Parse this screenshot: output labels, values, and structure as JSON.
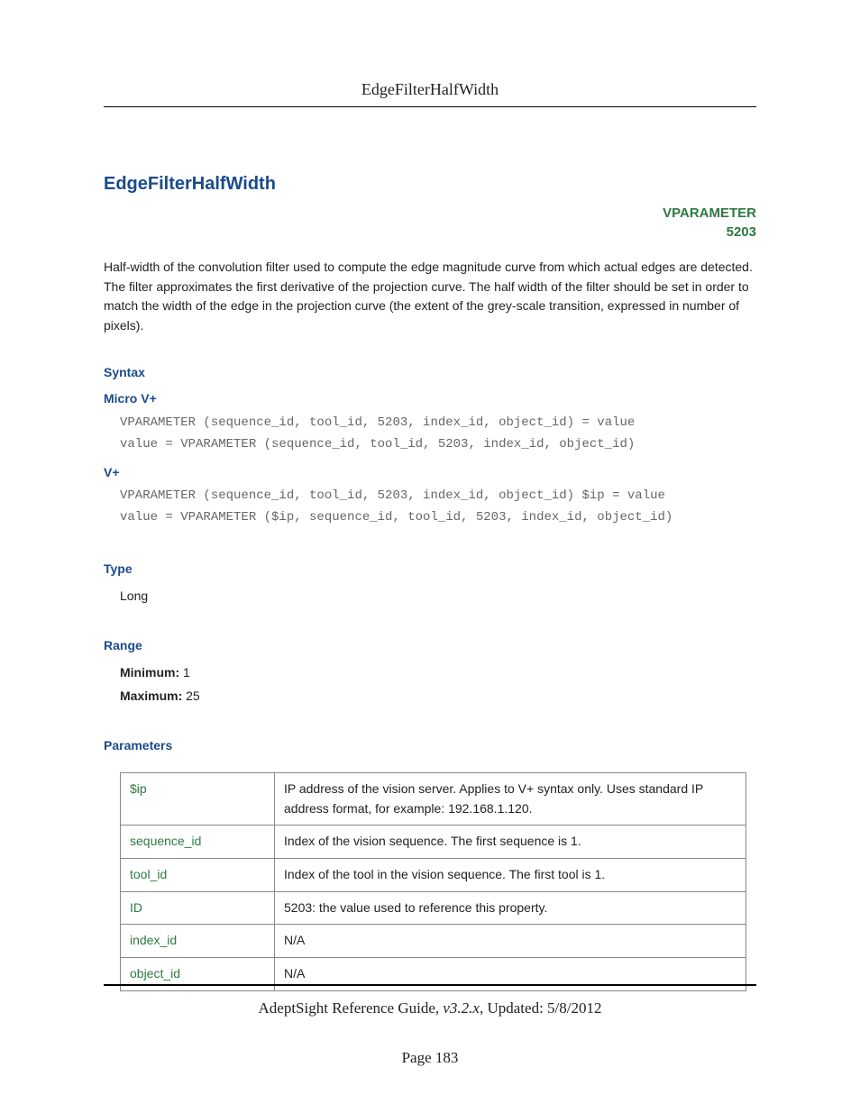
{
  "header": {
    "running_title": "EdgeFilterHalfWidth"
  },
  "title": "EdgeFilterHalfWidth",
  "vparam": {
    "label": "VPARAMETER",
    "id": "5203"
  },
  "description": "Half-width of the convolution filter used to compute the edge magnitude curve from which actual edges are detected. The filter approximates the first derivative of the projection curve. The half width of the filter should be set in order to match the width of the edge in the projection curve (the extent of the grey-scale transition, expressed in number of pixels).",
  "syntax": {
    "heading": "Syntax",
    "micro_heading": "Micro V+",
    "micro_code": "VPARAMETER (sequence_id, tool_id, 5203, index_id, object_id) = value\nvalue = VPARAMETER (sequence_id, tool_id, 5203, index_id, object_id)",
    "vplus_heading": "V+",
    "vplus_code": "VPARAMETER (sequence_id, tool_id, 5203, index_id, object_id) $ip = value\nvalue = VPARAMETER ($ip, sequence_id, tool_id, 5203, index_id, object_id)"
  },
  "type_section": {
    "heading": "Type",
    "value": "Long"
  },
  "range": {
    "heading": "Range",
    "min_label": "Minimum:",
    "min_value": "1",
    "max_label": "Maximum:",
    "max_value": "25"
  },
  "parameters": {
    "heading": "Parameters",
    "rows": [
      {
        "name": "$ip",
        "desc": "IP address of the vision server. Applies to V+ syntax only. Uses standard IP address format, for example: 192.168.1.120."
      },
      {
        "name": "sequence_id",
        "desc": "Index of the vision sequence. The first sequence is 1."
      },
      {
        "name": "tool_id",
        "desc": "Index of the tool in the vision sequence. The first tool is 1."
      },
      {
        "name": "ID",
        "desc": "5203: the value used to reference this property."
      },
      {
        "name": "index_id",
        "desc": "N/A"
      },
      {
        "name": "object_id",
        "desc": "N/A"
      }
    ]
  },
  "footer": {
    "guide": "AdeptSight Reference Guide",
    "version": ", v3.2.x",
    "updated": ", Updated: 5/8/2012",
    "page": "Page 183"
  }
}
